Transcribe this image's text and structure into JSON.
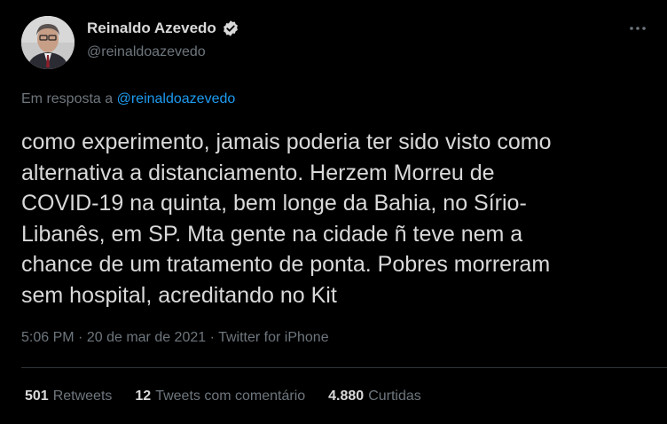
{
  "author": {
    "display_name": "Reinaldo Azevedo",
    "handle": "@reinaldoazevedo",
    "verified": true
  },
  "reply": {
    "prefix": "Em resposta a",
    "mention": "@reinaldoazevedo"
  },
  "tweet": {
    "text": "como experimento, jamais poderia ter sido visto como\nalternativa a distanciamento. Herzem Morreu de\nCOVID-19 na quinta, bem longe da Bahia, no Sírio-\nLibanês, em SP. Mta gente na cidade ñ teve nem a\nchance de um tratamento de ponta. Pobres morreram\nsem hospital, acreditando no Kit"
  },
  "meta": {
    "time": "5:06 PM",
    "sep1": "·",
    "date": "20 de mar de 2021",
    "sep2": "·",
    "source": "Twitter for iPhone"
  },
  "stats": [
    {
      "count": "501",
      "label": "Retweets"
    },
    {
      "count": "12",
      "label": "Tweets com comentário"
    },
    {
      "count": "4.880",
      "label": "Curtidas"
    }
  ],
  "icons": {
    "verified": "verified-badge-icon",
    "more": "more-options-icon"
  },
  "colors": {
    "background": "#000000",
    "text": "#d9d9d9",
    "secondary": "#6e767d",
    "link": "#1d9bf0",
    "divider": "#2f3336"
  }
}
